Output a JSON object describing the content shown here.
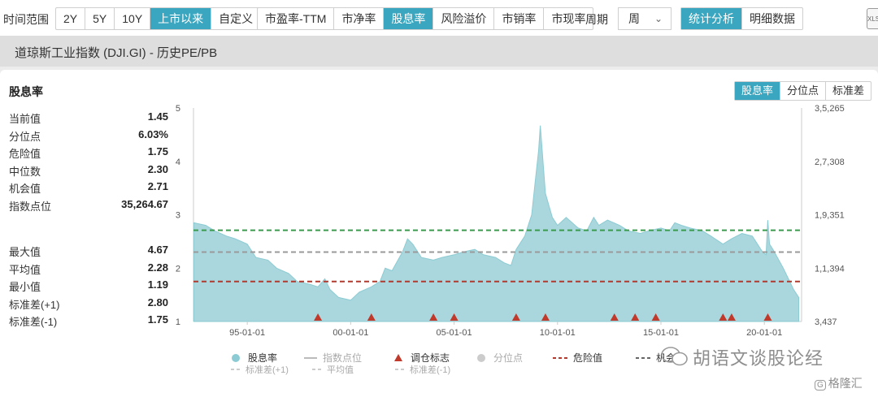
{
  "toolbar": {
    "range_label": "时间范围",
    "range_buttons": [
      "2Y",
      "5Y",
      "10Y",
      "上市以来",
      "自定义"
    ],
    "range_active": 3,
    "metric_buttons": [
      "市盈率-TTM",
      "市净率",
      "股息率",
      "风险溢价",
      "市销率",
      "市现率"
    ],
    "metric_active": 2,
    "period_label": "周期",
    "period_value": "周",
    "view_buttons": [
      "统计分析",
      "明细数据"
    ],
    "view_active": 0,
    "export_label": "XLS"
  },
  "title": "道琼斯工业指数 (DJI.GI) - 历史PE/PB",
  "panel": {
    "title": "股息率",
    "tabs": [
      "股息率",
      "分位点",
      "标准差"
    ],
    "tabs_active": 0
  },
  "stats_top": [
    {
      "k": "当前值",
      "v": "1.45"
    },
    {
      "k": "分位点",
      "v": "6.03%"
    },
    {
      "k": "危险值",
      "v": "1.75"
    },
    {
      "k": "中位数",
      "v": "2.30"
    },
    {
      "k": "机会值",
      "v": "2.71"
    },
    {
      "k": "指数点位",
      "v": "35,264.67"
    }
  ],
  "stats_bottom": [
    {
      "k": "最大值",
      "v": "4.67"
    },
    {
      "k": "平均值",
      "v": "2.28"
    },
    {
      "k": "最小值",
      "v": "1.19"
    },
    {
      "k": "标准差(+1)",
      "v": "2.80"
    },
    {
      "k": "标准差(-1)",
      "v": "1.75"
    }
  ],
  "watermark": "胡语文谈股论经",
  "brand": "格隆汇",
  "colors": {
    "accent": "#3aa6bf",
    "area": "#a9d7dd",
    "area_line": "#8ccbd3",
    "opportunity": "#3b9a4e",
    "median": "#9a9a9a",
    "danger": "#b03a2e",
    "marker": "#c0392b"
  },
  "chart_data": {
    "type": "area",
    "series": [
      {
        "name": "股息率",
        "x": [
          "1992-06",
          "1993-01",
          "1993-06",
          "1994-01",
          "1994-06",
          "1995-01",
          "1995-06",
          "1996-01",
          "1996-06",
          "1997-01",
          "1997-06",
          "1998-01",
          "1998-06",
          "1998-10",
          "1999-01",
          "1999-06",
          "2000-01",
          "2000-06",
          "2001-01",
          "2001-06",
          "2001-09",
          "2002-01",
          "2002-07",
          "2002-10",
          "2003-01",
          "2003-06",
          "2004-01",
          "2004-06",
          "2005-01",
          "2005-06",
          "2006-01",
          "2006-06",
          "2007-01",
          "2007-06",
          "2007-10",
          "2008-01",
          "2008-06",
          "2008-10",
          "2008-12",
          "2009-02",
          "2009-03",
          "2009-06",
          "2009-10",
          "2010-01",
          "2010-06",
          "2011-01",
          "2011-06",
          "2011-10",
          "2012-01",
          "2012-06",
          "2013-01",
          "2013-06",
          "2014-01",
          "2014-06",
          "2015-01",
          "2015-06",
          "2015-09",
          "2016-01",
          "2016-06",
          "2017-01",
          "2017-06",
          "2018-01",
          "2018-06",
          "2018-12",
          "2019-06",
          "2019-12",
          "2020-02",
          "2020-03",
          "2020-04",
          "2020-06",
          "2020-12",
          "2021-06",
          "2021-09"
        ],
        "values": [
          2.85,
          2.8,
          2.7,
          2.6,
          2.55,
          2.45,
          2.2,
          2.15,
          2.0,
          1.9,
          1.75,
          1.7,
          1.65,
          1.8,
          1.6,
          1.45,
          1.4,
          1.55,
          1.65,
          1.75,
          2.0,
          1.95,
          2.3,
          2.55,
          2.45,
          2.2,
          2.15,
          2.2,
          2.25,
          2.3,
          2.35,
          2.25,
          2.2,
          2.1,
          2.05,
          2.35,
          2.6,
          3.0,
          3.6,
          4.2,
          4.67,
          3.4,
          2.95,
          2.8,
          2.95,
          2.75,
          2.7,
          2.95,
          2.8,
          2.9,
          2.8,
          2.7,
          2.65,
          2.7,
          2.75,
          2.7,
          2.85,
          2.8,
          2.75,
          2.7,
          2.6,
          2.45,
          2.55,
          2.65,
          2.6,
          2.3,
          2.25,
          2.9,
          2.45,
          2.35,
          2.0,
          1.6,
          1.45
        ]
      }
    ],
    "reference_lines": [
      {
        "name": "机会值",
        "value": 2.71
      },
      {
        "name": "中位数",
        "value": 2.3
      },
      {
        "name": "危险值",
        "value": 1.75
      }
    ],
    "markers": {
      "name": "调仓标志",
      "x": [
        "1998-06",
        "2001-01",
        "2004-01",
        "2005-01",
        "2008-01",
        "2009-06",
        "2012-10",
        "2013-10",
        "2014-10",
        "2018-01",
        "2018-06",
        "2020-03"
      ]
    },
    "x_ticks": [
      "95-01-01",
      "00-01-01",
      "05-01-01",
      "10-01-01",
      "15-01-01",
      "20-01-01"
    ],
    "y_left": {
      "ticks": [
        "1",
        "2",
        "3",
        "4",
        "5"
      ],
      "lim": [
        1,
        5
      ]
    },
    "y_right": {
      "ticks": [
        "3,437",
        "1,1,394",
        "1,9,351",
        "2,7,308",
        "3,5,265"
      ]
    },
    "legend": {
      "row1": [
        "股息率",
        "指数点位",
        "调仓标志",
        "分位点",
        "危险值",
        "机会值"
      ],
      "row2": [
        "标准差(+1)",
        "平均值",
        "标准差(-1)"
      ]
    }
  }
}
